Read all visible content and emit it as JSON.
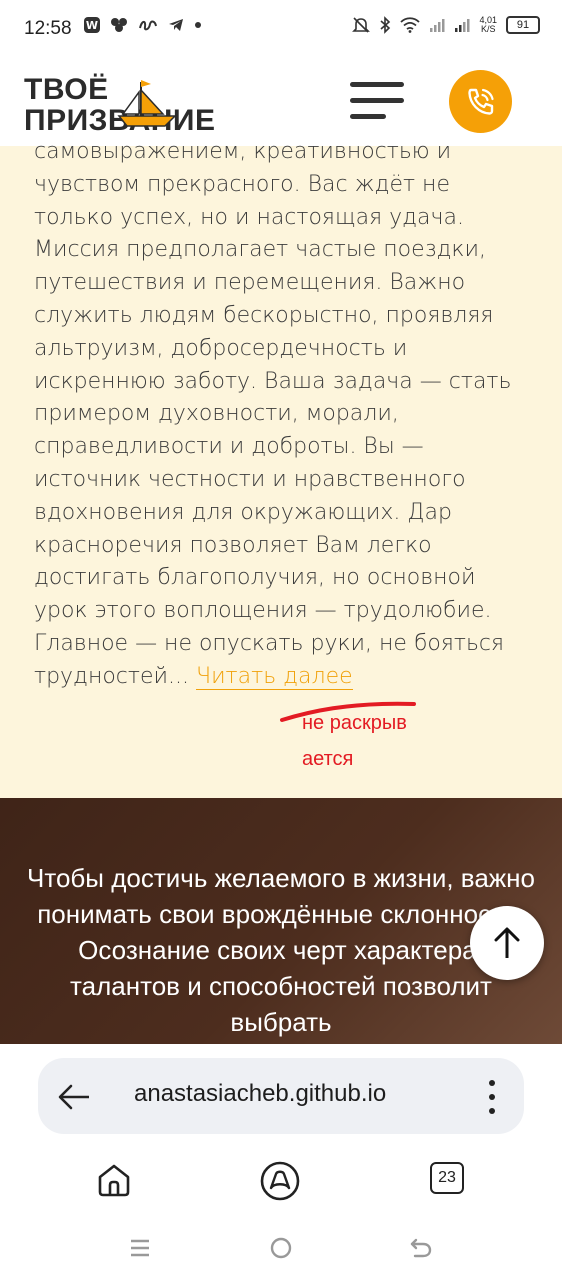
{
  "status_bar": {
    "time": "12:58",
    "net_speed_value": "4,01",
    "net_speed_unit": "K/S",
    "battery": "91",
    "icons": [
      "w-app-icon",
      "flower-app-icon",
      "handwriting-app-icon",
      "telegram-icon",
      "dot-icon",
      "mute-icon",
      "bluetooth-icon",
      "wifi-icon",
      "signal-icon",
      "signal-icon"
    ]
  },
  "header": {
    "logo_line1": "ТВОЁ",
    "logo_line2": "ПРИЗВАНИЕ",
    "menu_icon": "hamburger-icon",
    "call_icon": "phone-icon",
    "accent_color": "#f5a007"
  },
  "content": {
    "paragraph": "самовыражением, креативностью и чувством прекрасного. Вас ждёт не только успех, но и настоящая удача. Миссия предполагает частые поездки, путешествия и перемещения. Важно служить людям бескорыстно, проявляя альтруизм, добросердечность и искреннюю заботу. Ваша задача — стать примером духовности, морали, справедливости и доброты. Вы — источник честности и нравственного вдохновения для окружающих. Дар красноречия позволяет Вам легко достигать благополучия, но основной урок этого воплощения — трудолюбие. Главное — не опускать руки, не бояться трудностей...",
    "read_more": "Читать далее",
    "annotation_line1": "не раскрыв",
    "annotation_line2": "ается",
    "annotation_color": "#e31b23"
  },
  "promo": {
    "text": "Чтобы достичь желаемого в жизни, важно понимать свои врождённые склонности. Осознание своих черт характера, талантов и способностей позволит выбрать"
  },
  "scroll_top_icon": "arrow-up-icon",
  "browser": {
    "url": "anastasiacheb.github.io",
    "back_icon": "arrow-left-icon",
    "menu_icon": "kebab-menu-icon",
    "home_icon": "home-icon",
    "assistant_icon": "alice-icon",
    "tabs_count": "23"
  },
  "system_nav": {
    "recents_icon": "recents-icon",
    "home_icon": "circle-home-icon",
    "back_icon": "back-icon"
  }
}
